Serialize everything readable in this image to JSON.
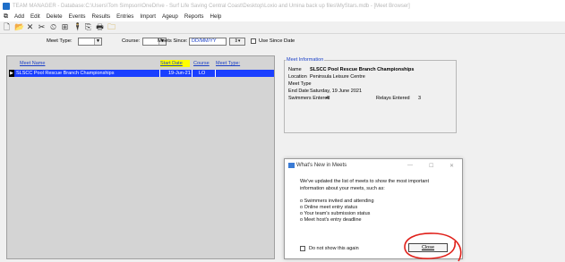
{
  "window": {
    "title": "TEAM MANAGER - Database:C:\\Users\\Tom Simpson\\OneDrive - Surf Life Saving Central Coast\\Desktop\\Loxio and Umina back up files\\MyStars.mdb - [Meet Browser]"
  },
  "menu": [
    "Add",
    "Edit",
    "Delete",
    "Events",
    "Results",
    "Entries",
    "Import",
    "Ageup",
    "Reports",
    "Help"
  ],
  "toolbar_icons": [
    "new-icon",
    "open-icon",
    "delete-icon",
    "cut-icon",
    "clock-icon",
    "grid-icon",
    "person-icon",
    "copy-icon",
    "print-icon",
    "folder-icon"
  ],
  "filters": {
    "meet_type_label": "Meet Type:",
    "course_label": "Course:",
    "meets_since_label": "Meets Since:",
    "meets_since_value": "DD/MM/YY",
    "use_since_date_label": "Use Since Date"
  },
  "table": {
    "headers": {
      "meet_name": "Meet Name",
      "start_date": "Start Date",
      "course": "Course",
      "meet_type": "Meet Type:"
    },
    "rows": [
      {
        "meet_name": "SLSCC Pool Rescue Branch Championships",
        "start_date": "19-Jun-21",
        "course": "LO",
        "meet_type": ""
      }
    ]
  },
  "meet_info": {
    "legend": "Meet Information",
    "name_label": "Name",
    "name_value": "SLSCC Pool Rescue Branch Championships",
    "location_label": "Location",
    "location_value": "Peninsula Leisure Centre",
    "meet_type_label": "Meet Type",
    "end_date_label": "End Date",
    "end_date_value": "Saturday, 19 June 2021",
    "swimmers_label": "Swimmers Entered",
    "swimmers_value": "4",
    "relays_label": "Relays Entered",
    "relays_value": "3"
  },
  "dialog": {
    "title": "What's New in Meets",
    "minimize": "—",
    "maximize": "☐",
    "close_x": "✕",
    "intro_1": "We've updated the list of meets to show the most important",
    "intro_2": "information about your meets, such as:",
    "bullets": [
      "o Swimmers invited and attending",
      "o Online meet entry status",
      "o Your team's submission status",
      "o Meet host's entry deadline"
    ],
    "dont_show": "Do not show this again",
    "close_button": "Close"
  },
  "colors": {
    "selection": "#1a3fff",
    "link": "#1a3fc7",
    "sort_highlight": "#ffff00",
    "annotation": "#e0201a"
  }
}
